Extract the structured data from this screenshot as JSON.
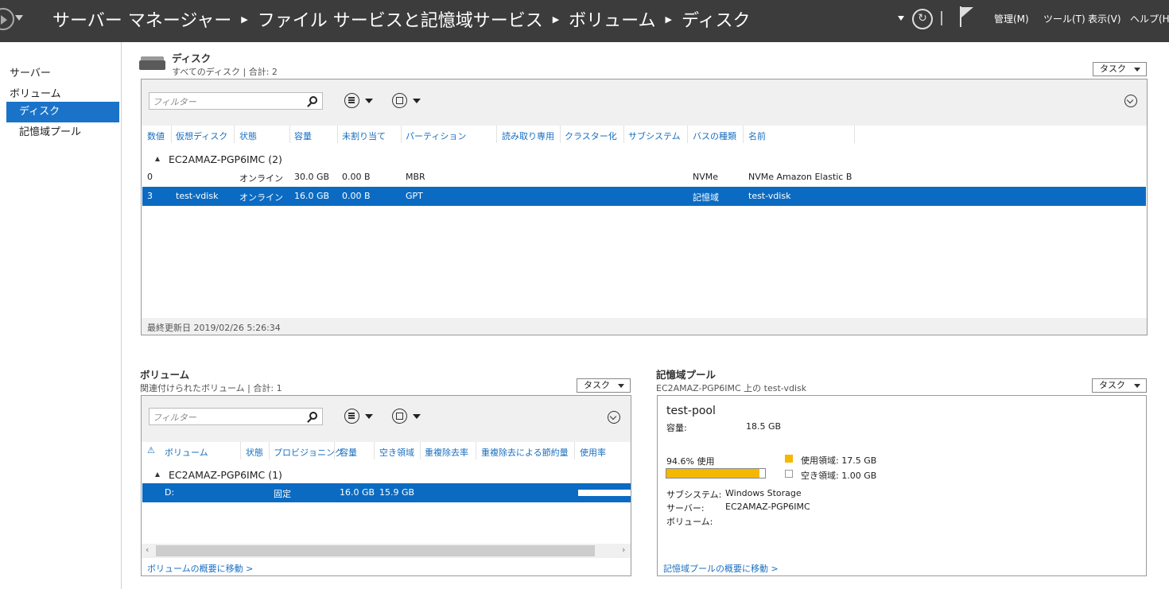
{
  "titlebar": {
    "breadcrumb": [
      "サーバー マネージャー",
      "ファイル サービスと記憶域サービス",
      "ボリューム",
      "ディスク"
    ],
    "menu": {
      "manage": "管理(M)",
      "tools": "ツール(T)",
      "view": "表示(V)",
      "help": "ヘルプ(H)"
    }
  },
  "leftnav": {
    "items": [
      "サーバー",
      "ボリューム"
    ],
    "subitems": [
      "ディスク",
      "記憶域プール"
    ]
  },
  "disks": {
    "title": "ディスク",
    "subtitle": "すべてのディスク | 合計: 2",
    "task_label": "タスク",
    "filter_placeholder": "フィルター",
    "columns": [
      "数値",
      "仮想ディスク",
      "状態",
      "容量",
      "未割り当て",
      "パーティション",
      "読み取り専用",
      "クラスター化",
      "サブシステム",
      "バスの種類",
      "名前"
    ],
    "group": "EC2AMAZ-PGP6IMC (2)",
    "rows": [
      {
        "number": "0",
        "virtual_disk": "",
        "status": "オンライン",
        "capacity": "30.0 GB",
        "unallocated": "0.00 B",
        "partition": "MBR",
        "read_only": "",
        "clustered": "",
        "subsystem": "",
        "bus_type": "NVMe",
        "name": "NVMe Amazon Elastic B",
        "selected": false
      },
      {
        "number": "3",
        "virtual_disk": "test-vdisk",
        "status": "オンライン",
        "capacity": "16.0 GB",
        "unallocated": "0.00 B",
        "partition": "GPT",
        "read_only": "",
        "clustered": "",
        "subsystem": "",
        "bus_type": "記憶域",
        "name": "test-vdisk",
        "selected": true
      }
    ],
    "footer": "最終更新日 2019/02/26 5:26:34"
  },
  "volumes": {
    "title": "ボリューム",
    "subtitle": "関連付けられたボリューム | 合計: 1",
    "task_label": "タスク",
    "filter_placeholder": "フィルター",
    "columns": [
      "ボリューム",
      "状態",
      "プロビジョニング",
      "容量",
      "空き領域",
      "重複除去率",
      "重複除去による節約量",
      "使用率"
    ],
    "group": "EC2AMAZ-PGP6IMC (1)",
    "rows": [
      {
        "volume": "D:",
        "status": "",
        "provisioning": "固定",
        "capacity": "16.0 GB",
        "free": "15.9 GB",
        "dedup_rate": "",
        "dedup_savings": "",
        "usage": ""
      }
    ],
    "link": "ボリュームの概要に移動 >"
  },
  "pool": {
    "title": "記憶域プール",
    "subtitle": "EC2AMAZ-PGP6IMC 上の test-vdisk",
    "task_label": "タスク",
    "name": "test-pool",
    "capacity_label": "容量:",
    "capacity_value": "18.5 GB",
    "used_pct_label": "94.6% 使用",
    "used_fraction": 0.946,
    "legend_used": "使用領域: 17.5 GB",
    "legend_free": "空き領域: 1.00 GB",
    "used_color": "#f5b800",
    "subsystem_label": "サブシステム:",
    "subsystem_value": "Windows Storage",
    "server_label": "サーバー:",
    "server_value": "EC2AMAZ-PGP6IMC",
    "volume_label": "ボリューム:",
    "volume_value": "",
    "link": "記憶域プールの概要に移動 >"
  }
}
